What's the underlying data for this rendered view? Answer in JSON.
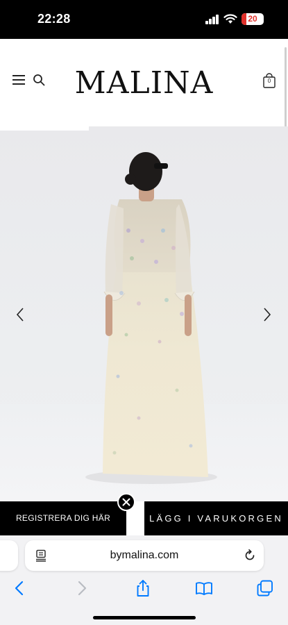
{
  "status_bar": {
    "time": "22:28",
    "battery_level": "20",
    "battery_color": "#e0302a"
  },
  "site": {
    "logo": "MALINA",
    "cart_count": "0",
    "icons": [
      "menu-icon",
      "search-icon",
      "shopping-bag-icon"
    ]
  },
  "product_image": {
    "description_icon": "dress-photo",
    "prev_icon": "chevron-left-icon",
    "next_icon": "chevron-right-icon"
  },
  "sticky_bar": {
    "register_label": "REGISTRERA DIG HÄR",
    "add_to_cart_label": "LÄGG I VARUKORGEN",
    "close_icon": "close-icon"
  },
  "browser": {
    "url": "bymalina.com",
    "toolbar_icons": [
      "back-icon",
      "forward-icon",
      "share-icon",
      "bookmarks-icon",
      "tabs-icon"
    ],
    "accent": "#007aff"
  }
}
